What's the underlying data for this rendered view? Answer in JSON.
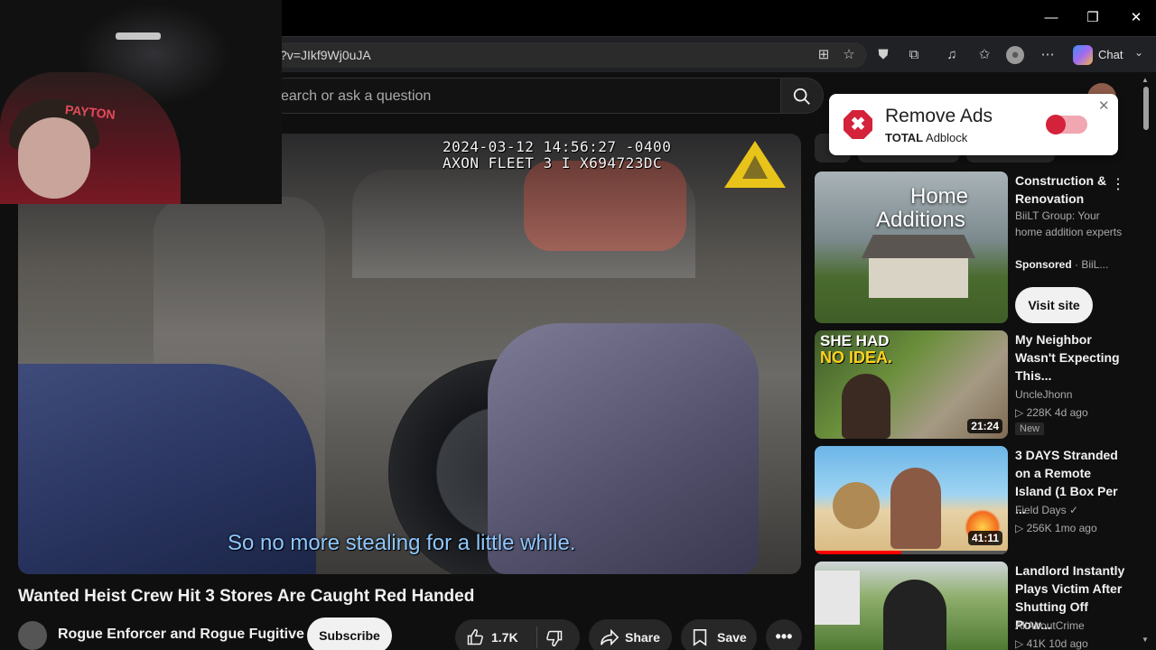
{
  "window": {
    "minimize": "—",
    "maximize": "❐",
    "close": "✕"
  },
  "browser": {
    "url": "?v=JIkf9Wj0uJA",
    "chat_label": "Chat"
  },
  "youtube": {
    "search_placeholder": "earch or ask a question"
  },
  "video": {
    "timestamp_line1": "2024-03-12 14:56:27 -0400",
    "timestamp_line2": "AXON FLEET 3 I X694723DC",
    "subtitle": "So no more stealing for a little while.",
    "title": "Wanted Heist Crew Hit 3 Stores Are Caught Red Handed",
    "channel": "Rogue Enforcer and Rogue Fugitive",
    "subscribe": "Subscribe",
    "likes": "1.7K",
    "share": "Share",
    "save": "Save",
    "more": "•••"
  },
  "webcam": {
    "shirt_text": "PAYTON"
  },
  "adblock": {
    "title": "Remove Ads",
    "brand": "TOTAL",
    "product": "Adblock",
    "close": "✕",
    "logo": "✖"
  },
  "recommendations": [
    {
      "thumb_text_1": "Home",
      "thumb_text_2": "Additions",
      "title": "Construction & Renovation",
      "meta1": "BiiLT Group: Your home addition experts",
      "sponsored": "Sponsored",
      "sponsored_suffix": " · BiiL...",
      "cta": "Visit site"
    },
    {
      "thumb_text_1": "SHE HAD",
      "thumb_text_2": "NO IDEA.",
      "title": "My Neighbor Wasn't Expecting This...",
      "channel": "UncleJhonn",
      "stats": "▷ 228K  4d ago",
      "badge": "New",
      "duration": "21:24"
    },
    {
      "title": "3 DAYS Stranded on a Remote Island (1 Box Per ...",
      "channel": "Field Days ✓",
      "stats": "▷ 256K  1mo ago",
      "duration": "41:11",
      "progress": 0.45
    },
    {
      "title": "Landlord Instantly Plays Victim After Shutting Off Pow...",
      "channel": "AllAboutCrime",
      "stats": "▷ 41K  10d ago"
    }
  ],
  "colors": {
    "accent_red": "#ff0000",
    "adblock_red": "#d3223a",
    "subtitle_blue": "#8fc8ff"
  }
}
